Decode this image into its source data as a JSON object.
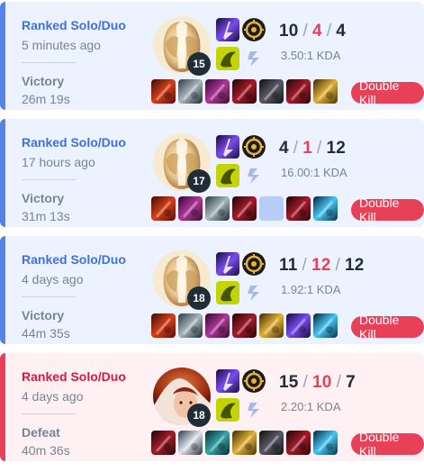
{
  "matches": [
    {
      "result_class": "win",
      "queue": "Ranked Solo/Duo",
      "time_ago": "5 minutes ago",
      "result": "Victory",
      "duration": "26m 19s",
      "champion_icon": "helmet-champion",
      "level": "15",
      "kills": "10",
      "deaths": "4",
      "assists": "4",
      "kda_ratio": "3.50:1 KDA",
      "items": [
        "red-blade",
        "gray-boots",
        "purple-sword",
        "red-gauntlet",
        "dark-claws",
        "crimson-dagger",
        "gold-trinket"
      ],
      "badge": "Double Kill"
    },
    {
      "result_class": "win",
      "queue": "Ranked Solo/Duo",
      "time_ago": "17 hours ago",
      "result": "Victory",
      "duration": "31m 13s",
      "champion_icon": "helmet-champion",
      "level": "17",
      "kills": "4",
      "deaths": "1",
      "assists": "12",
      "kda_ratio": "16.00:1 KDA",
      "items": [
        "red-blade",
        "purple-sword",
        "gray-boots",
        "red-gauntlet",
        "empty",
        "crimson-dagger",
        "blue-orb"
      ],
      "badge": "Double Kill"
    },
    {
      "result_class": "win",
      "queue": "Ranked Solo/Duo",
      "time_ago": "4 days ago",
      "result": "Victory",
      "duration": "44m 35s",
      "champion_icon": "helmet-champion",
      "level": "18",
      "kills": "11",
      "deaths": "12",
      "assists": "12",
      "kda_ratio": "1.92:1 KDA",
      "items": [
        "red-blade",
        "gray-boots",
        "purple-sword",
        "red-gauntlet",
        "gold-claws",
        "violet-staff",
        "blue-orb"
      ],
      "badge": "Double Kill"
    },
    {
      "result_class": "loss",
      "queue": "Ranked Solo/Duo",
      "time_ago": "4 days ago",
      "result": "Defeat",
      "duration": "40m 36s",
      "champion_icon": "redhead-champion",
      "level": "18",
      "kills": "15",
      "deaths": "10",
      "assists": "7",
      "kda_ratio": "2.20:1 KDA",
      "items": [
        "crimson-armor",
        "silver-blade",
        "teal-helm",
        "gold-claws",
        "dark-claws",
        "red-gauntlet",
        "blue-orb"
      ],
      "badge": "Double Kill"
    }
  ],
  "colors": {
    "win_bg": "#ecf2ff",
    "win_accent": "#5383e8",
    "loss_bg": "#fff1f3",
    "loss_accent": "#e84057",
    "badge": "#e84057"
  }
}
